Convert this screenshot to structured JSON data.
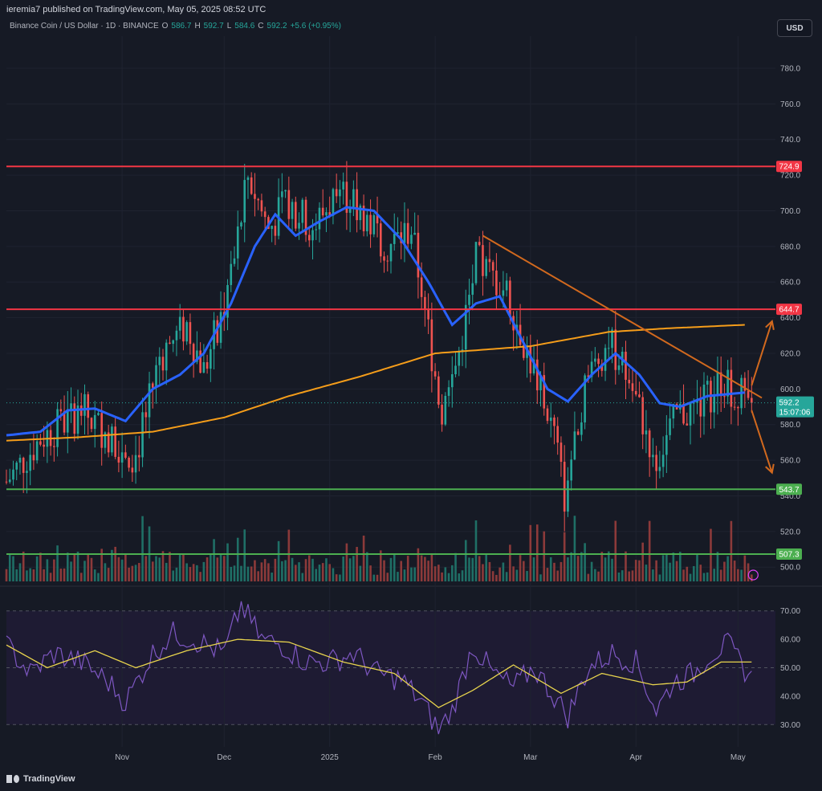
{
  "header": {
    "publisher_line": "ieremia7 published on TradingView.com, May 05, 2025 08:52 UTC"
  },
  "symbol": {
    "title": "Binance Coin / US Dollar · 1D · BINANCE",
    "open_label": "O",
    "open": "586.7",
    "high_label": "H",
    "high": "592.7",
    "low_label": "L",
    "low": "584.6",
    "close_label": "C",
    "close": "592.2",
    "change": "+5.6 (+0.95%)"
  },
  "currency_button": "USD",
  "footer": {
    "brand": "TradingView"
  },
  "colors": {
    "background": "#161a25",
    "up": "#26a69a",
    "down": "#ef5350",
    "ema_short": "#2962ff",
    "ema_long": "#f59d1a",
    "resistance": "#f23645",
    "support": "#4caf50",
    "trendline": "#d2691e",
    "rsi_line": "#7e57c2",
    "rsi_ma": "#e8d44d"
  },
  "chart_data": {
    "type": "candlestick",
    "price_axis": {
      "ylim": [
        492,
        798
      ],
      "ticks": [
        "780.0",
        "760.0",
        "740.0",
        "720.0",
        "700.0",
        "680.0",
        "660.0",
        "640.0",
        "620.0",
        "600.0",
        "580.0",
        "560.0",
        "540.0",
        "520.0",
        "500.0"
      ],
      "tick_values": [
        780,
        760,
        740,
        720,
        700,
        680,
        660,
        640,
        620,
        600,
        580,
        560,
        540,
        520,
        500
      ]
    },
    "x_axis": {
      "range": [
        "2024-09-28",
        "2025-05-12"
      ],
      "labels": [
        {
          "text": "Nov",
          "date": "2024-11-01"
        },
        {
          "text": "Dec",
          "date": "2024-12-01"
        },
        {
          "text": "2025",
          "date": "2025-01-01"
        },
        {
          "text": "Feb",
          "date": "2025-02-01"
        },
        {
          "text": "Mar",
          "date": "2025-03-01"
        },
        {
          "text": "Apr",
          "date": "2025-04-01"
        },
        {
          "text": "May",
          "date": "2025-05-01"
        }
      ]
    },
    "price_anchor_dates": [
      "2024-09-28",
      "2024-10-08",
      "2024-10-20",
      "2024-10-28",
      "2024-11-05",
      "2024-11-12",
      "2024-11-20",
      "2024-11-25",
      "2024-12-03",
      "2024-12-08",
      "2024-12-14",
      "2024-12-20",
      "2024-12-27",
      "2025-01-04",
      "2025-01-10",
      "2025-01-18",
      "2025-01-25",
      "2025-02-03",
      "2025-02-08",
      "2025-02-13",
      "2025-02-22",
      "2025-03-02",
      "2025-03-08",
      "2025-03-11",
      "2025-03-17",
      "2025-03-24",
      "2025-03-30",
      "2025-04-07",
      "2025-04-13",
      "2025-04-20",
      "2025-04-26",
      "2025-05-05"
    ],
    "price_anchor_closes": [
      548,
      572,
      588,
      574,
      562,
      618,
      636,
      610,
      660,
      720,
      690,
      705,
      690,
      712,
      700,
      680,
      690,
      585,
      620,
      672,
      655,
      610,
      575,
      540,
      602,
      628,
      605,
      560,
      585,
      590,
      605,
      592.2
    ],
    "last_close": 592.2,
    "ema_short": {
      "anchor_dates": [
        "2024-09-28",
        "2024-10-08",
        "2024-10-16",
        "2024-10-24",
        "2024-11-02",
        "2024-11-10",
        "2024-11-18",
        "2024-11-25",
        "2024-12-03",
        "2024-12-10",
        "2024-12-16",
        "2024-12-22",
        "2024-12-29",
        "2025-01-06",
        "2025-01-14",
        "2025-01-22",
        "2025-01-30",
        "2025-02-06",
        "2025-02-13",
        "2025-02-20",
        "2025-02-28",
        "2025-03-06",
        "2025-03-12",
        "2025-03-19",
        "2025-03-26",
        "2025-04-02",
        "2025-04-08",
        "2025-04-14",
        "2025-04-22",
        "2025-05-03"
      ],
      "anchor_values": [
        574,
        576,
        588,
        589,
        582,
        600,
        608,
        620,
        648,
        680,
        698,
        686,
        694,
        702,
        700,
        684,
        660,
        636,
        648,
        652,
        622,
        600,
        593,
        608,
        620,
        608,
        592,
        590,
        596,
        598
      ]
    },
    "ema_long": {
      "anchor_dates": [
        "2024-09-28",
        "2024-10-20",
        "2024-11-10",
        "2024-12-01",
        "2024-12-20",
        "2025-01-10",
        "2025-02-01",
        "2025-03-01",
        "2025-03-24",
        "2025-04-10",
        "2025-05-03"
      ],
      "anchor_values": [
        571,
        573,
        576,
        584,
        596,
        607,
        620,
        624,
        632,
        634,
        636
      ]
    },
    "resistance_levels": [
      {
        "value": 724.9,
        "label": "724.9"
      },
      {
        "value": 644.7,
        "label": "644.7"
      }
    ],
    "support_levels": [
      {
        "value": 543.7,
        "label": "543.7"
      },
      {
        "value": 507.3,
        "label": "507.3"
      }
    ],
    "current_price_label": "592.2",
    "countdown_label": "15:07:06",
    "trendline": {
      "from": {
        "date": "2025-02-15",
        "value": 686
      },
      "to": {
        "date": "2025-05-08",
        "value": 595
      }
    },
    "arrows": [
      {
        "from": {
          "date": "2025-05-05",
          "value": 602
        },
        "to": {
          "date": "2025-05-11",
          "value": 638
        }
      },
      {
        "from": {
          "date": "2025-05-05",
          "value": 588
        },
        "to": {
          "date": "2025-05-11",
          "value": 553
        }
      }
    ],
    "rsi": {
      "ylim": [
        25,
        75
      ],
      "ticks": [
        "70.00",
        "60.00",
        "50.00",
        "40.00",
        "30.00"
      ],
      "tick_values": [
        70,
        60,
        50,
        40,
        30
      ],
      "band": [
        30,
        70
      ],
      "anchor_dates": [
        "2024-09-28",
        "2024-10-05",
        "2024-10-12",
        "2024-10-20",
        "2024-10-28",
        "2024-11-02",
        "2024-11-10",
        "2024-11-16",
        "2024-11-22",
        "2024-12-01",
        "2024-12-06",
        "2024-12-12",
        "2024-12-18",
        "2024-12-25",
        "2025-01-01",
        "2025-01-08",
        "2025-01-15",
        "2025-01-22",
        "2025-01-28",
        "2025-02-02",
        "2025-02-06",
        "2025-02-12",
        "2025-02-18",
        "2025-02-24",
        "2025-03-02",
        "2025-03-08",
        "2025-03-12",
        "2025-03-18",
        "2025-03-25",
        "2025-04-01",
        "2025-04-07",
        "2025-04-12",
        "2025-04-18",
        "2025-04-23",
        "2025-04-28",
        "2025-05-05"
      ],
      "anchor_values": [
        58,
        48,
        55,
        52,
        45,
        38,
        55,
        62,
        60,
        55,
        72,
        60,
        58,
        52,
        52,
        55,
        48,
        46,
        38,
        28,
        35,
        58,
        48,
        43,
        50,
        40,
        33,
        50,
        55,
        52,
        35,
        45,
        48,
        55,
        58,
        46
      ],
      "ma_anchor_dates": [
        "2024-09-28",
        "2024-10-10",
        "2024-10-24",
        "2024-11-05",
        "2024-11-20",
        "2024-12-05",
        "2024-12-20",
        "2025-01-05",
        "2025-01-20",
        "2025-02-02",
        "2025-02-12",
        "2025-02-24",
        "2025-03-10",
        "2025-03-22",
        "2025-04-06",
        "2025-04-16",
        "2025-04-26",
        "2025-05-05"
      ],
      "ma_anchor_values": [
        58,
        50,
        56,
        50,
        56,
        60,
        59,
        52,
        48,
        36,
        42,
        51,
        41,
        48,
        44,
        45,
        52,
        52
      ]
    }
  }
}
